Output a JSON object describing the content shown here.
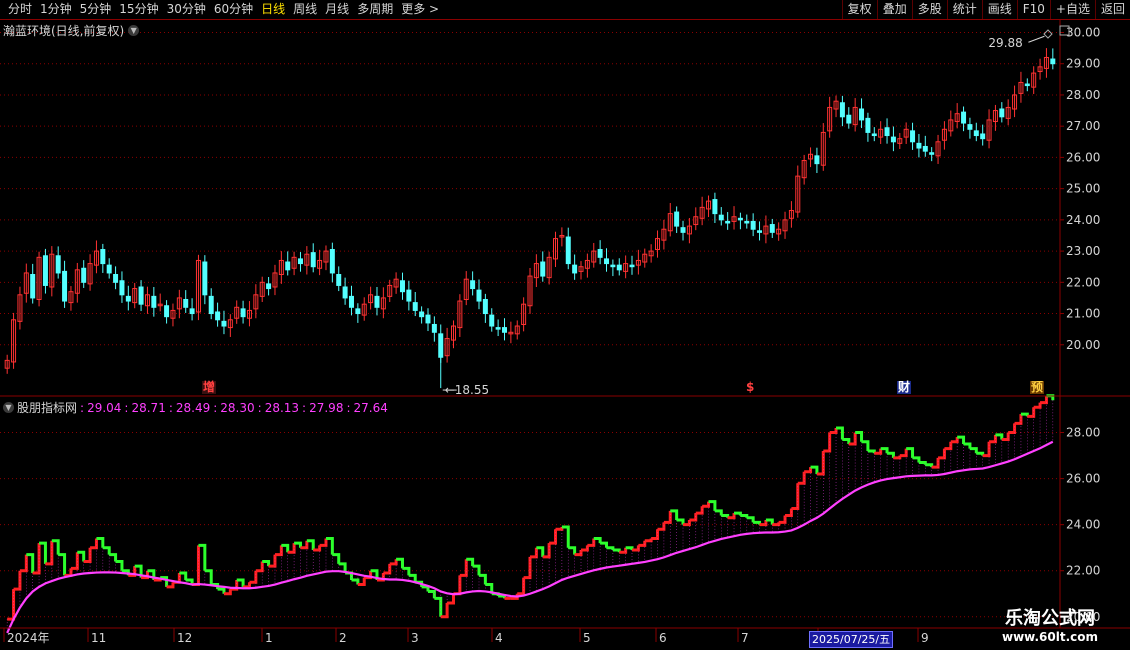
{
  "toolbar": {
    "periods": [
      "分时",
      "1分钟",
      "5分钟",
      "15分钟",
      "30分钟",
      "60分钟",
      "日线",
      "周线",
      "月线",
      "多周期",
      "更多 >"
    ],
    "active_period": "日线",
    "buttons": [
      "复权",
      "叠加",
      "多股",
      "统计",
      "画线",
      "F10",
      "+自选",
      "返回"
    ]
  },
  "stock": {
    "title": "瀚蓝环境(日线,前复权)"
  },
  "price_axis": {
    "labels": [
      "30.00",
      "29.00",
      "28.00",
      "27.00",
      "26.00",
      "25.00",
      "24.00",
      "23.00",
      "22.00",
      "21.00",
      "20.00"
    ]
  },
  "markers": {
    "high": "29.88",
    "low": "18.55"
  },
  "events": [
    {
      "label": "增",
      "color": "#ff4040",
      "bg": "#3a1010"
    },
    {
      "label": "$",
      "color": "#ff4040",
      "bg": "#000000"
    },
    {
      "label": "财",
      "color": "#ffffff",
      "bg": "#1a2a8a"
    },
    {
      "label": "预",
      "color": "#ffd040",
      "bg": "#6a3a00"
    }
  ],
  "indicator": {
    "name": "股朋指标网",
    "values": [
      "29.04",
      "28.71",
      "28.49",
      "28.30",
      "28.13",
      "27.98",
      "27.64"
    ],
    "axis_labels": [
      "28.00",
      "26.00",
      "24.00",
      "22.00",
      "20.00"
    ]
  },
  "date_axis": {
    "labels": [
      "2024年",
      "11",
      "12",
      "1",
      "2",
      "3",
      "4",
      "5",
      "6",
      "7",
      "8",
      "9"
    ],
    "cursor_date": "2025/07/25/五"
  },
  "watermark": {
    "site_name": "乐淘公式网",
    "url": "www.60lt.com"
  },
  "colors": {
    "up": "#ff3232",
    "down": "#54ffff",
    "ribbon_up": "#ff2020",
    "ribbon_down": "#2cff2c",
    "ma": "#ff40ff",
    "grid": "#8a0000",
    "accent": "#ffe000"
  },
  "chart_data": {
    "type": "candlestick",
    "ylim": [
      19.0,
      30.4
    ],
    "closes": [
      19.5,
      20.8,
      21.6,
      22.3,
      21.5,
      22.8,
      21.9,
      22.9,
      22.3,
      21.4,
      21.7,
      22.4,
      22.0,
      22.6,
      23.0,
      22.6,
      22.3,
      22.0,
      21.6,
      21.4,
      21.8,
      21.3,
      21.6,
      21.2,
      21.3,
      20.9,
      21.1,
      21.5,
      21.2,
      21.0,
      22.7,
      21.6,
      21.0,
      20.8,
      20.6,
      20.8,
      21.2,
      20.9,
      21.1,
      21.6,
      22.0,
      21.8,
      22.3,
      22.7,
      22.4,
      22.8,
      22.6,
      22.9,
      22.5,
      22.7,
      23.0,
      22.3,
      21.9,
      21.5,
      21.2,
      21.0,
      21.3,
      21.6,
      21.2,
      21.5,
      21.9,
      22.1,
      21.7,
      21.4,
      21.1,
      20.9,
      20.7,
      20.4,
      19.6,
      20.2,
      20.6,
      21.4,
      22.1,
      21.8,
      21.4,
      21.0,
      20.6,
      20.5,
      20.4,
      20.4,
      20.6,
      21.3,
      22.2,
      22.6,
      22.2,
      22.8,
      23.4,
      23.5,
      22.6,
      22.3,
      22.5,
      22.7,
      23.0,
      22.8,
      22.6,
      22.5,
      22.4,
      22.6,
      22.5,
      22.7,
      22.9,
      23.0,
      23.4,
      23.7,
      24.2,
      23.8,
      23.6,
      23.8,
      24.1,
      24.4,
      24.6,
      24.2,
      24.0,
      23.9,
      24.1,
      24.0,
      23.9,
      23.7,
      23.6,
      23.8,
      23.6,
      23.7,
      24.0,
      24.3,
      25.4,
      25.9,
      26.1,
      25.8,
      26.8,
      27.6,
      27.8,
      27.3,
      27.1,
      27.6,
      27.2,
      26.8,
      26.7,
      26.9,
      26.7,
      26.5,
      26.6,
      26.9,
      26.5,
      26.3,
      26.2,
      26.1,
      26.5,
      26.9,
      27.2,
      27.4,
      27.1,
      26.9,
      26.7,
      26.6,
      27.2,
      27.5,
      27.3,
      27.6,
      28.0,
      28.4,
      28.3,
      28.7,
      28.9,
      29.2,
      29.0
    ],
    "ma": [
      19.3,
      19.9,
      20.4,
      20.8,
      21.1,
      21.3,
      21.45,
      21.55,
      21.65,
      21.72,
      21.78,
      21.84,
      21.88,
      21.9,
      21.92,
      21.93,
      21.93,
      21.92,
      21.9,
      21.88,
      21.85,
      21.8,
      21.76,
      21.7,
      21.66,
      21.6,
      21.55,
      21.5,
      21.46,
      21.4,
      21.42,
      21.4,
      21.37,
      21.33,
      21.3,
      21.26,
      21.25,
      21.24,
      21.24,
      21.26,
      21.3,
      21.34,
      21.4,
      21.48,
      21.55,
      21.63,
      21.7,
      21.78,
      21.84,
      21.9,
      21.96,
      21.98,
      21.98,
      21.95,
      21.9,
      21.84,
      21.78,
      21.74,
      21.68,
      21.64,
      21.62,
      21.62,
      21.6,
      21.56,
      21.5,
      21.42,
      21.34,
      21.24,
      21.1,
      21.02,
      20.98,
      21.0,
      21.06,
      21.1,
      21.12,
      21.1,
      21.06,
      21.0,
      20.95,
      20.9,
      20.88,
      20.92,
      21.0,
      21.1,
      21.2,
      21.32,
      21.46,
      21.6,
      21.7,
      21.78,
      21.86,
      21.94,
      22.02,
      22.08,
      22.14,
      22.18,
      22.22,
      22.26,
      22.3,
      22.34,
      22.38,
      22.44,
      22.5,
      22.58,
      22.68,
      22.78,
      22.86,
      22.94,
      23.02,
      23.12,
      23.22,
      23.3,
      23.38,
      23.44,
      23.5,
      23.56,
      23.6,
      23.63,
      23.65,
      23.66,
      23.66,
      23.67,
      23.7,
      23.75,
      23.86,
      24.0,
      24.16,
      24.3,
      24.48,
      24.7,
      24.92,
      25.12,
      25.3,
      25.48,
      25.62,
      25.74,
      25.84,
      25.92,
      25.98,
      26.02,
      26.06,
      26.1,
      26.12,
      26.13,
      26.14,
      26.14,
      26.16,
      26.2,
      26.26,
      26.32,
      26.36,
      26.4,
      26.42,
      26.44,
      26.5,
      26.58,
      26.66,
      26.74,
      26.84,
      26.96,
      27.08,
      27.2,
      27.32,
      27.46,
      27.6
    ]
  }
}
